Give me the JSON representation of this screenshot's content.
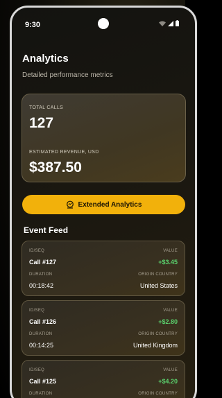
{
  "status": {
    "time": "9:30",
    "icons": [
      "wifi-icon",
      "signal-icon",
      "battery-icon"
    ]
  },
  "header": {
    "title": "Analytics",
    "subtitle": "Detailed performance metrics"
  },
  "summary": {
    "calls_label": "TOTAL CALLS",
    "calls_value": "127",
    "revenue_label": "ESTIMATED REVENUE, USD",
    "revenue_value": "$387.50"
  },
  "extended_button": {
    "label": "Extended Analytics",
    "icon": "analytics-icon"
  },
  "feed": {
    "title": "Event Feed",
    "labels": {
      "id": "ID/SEQ",
      "value": "VALUE",
      "duration": "DURATION",
      "origin": "ORIGIN COUNTRY"
    },
    "events": [
      {
        "id": "Call #127",
        "value": "+$3.45",
        "duration": "00:18:42",
        "origin": "United States"
      },
      {
        "id": "Call #126",
        "value": "+$2.80",
        "duration": "00:14:25",
        "origin": "United Kingdom"
      },
      {
        "id": "Call #125",
        "value": "+$4.20",
        "duration": "",
        "origin": ""
      }
    ]
  },
  "colors": {
    "accent": "#f2b10b",
    "positive": "#5bd16d",
    "background": "#000000"
  }
}
